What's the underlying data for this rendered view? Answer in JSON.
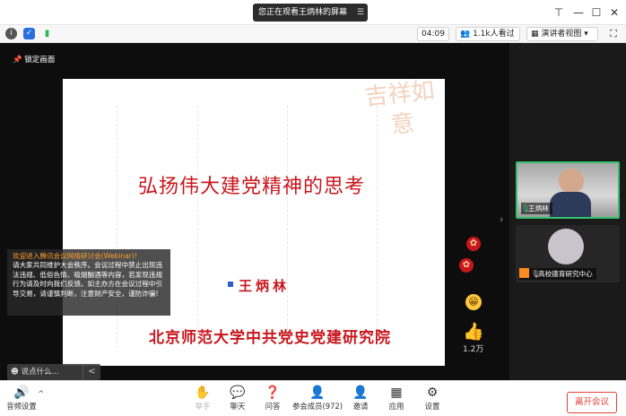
{
  "window": {
    "screen_notice": "您正在观看王炳林的屏幕",
    "minimize": "—",
    "maximize": "☐",
    "close": "✕",
    "pin": "⊤",
    "menu_glyph": "☰"
  },
  "info_bar": {
    "timer": "04:09",
    "viewers": "1.1k人看过",
    "view_mode": "演讲者视图",
    "fullscreen_glyph": "⛶"
  },
  "stage": {
    "lock_label": "锁定画面",
    "slide": {
      "title": "弘扬伟大建党精神的思考",
      "author": "王炳林",
      "institution": "北京师范大学中共党史党建研究院",
      "seal_text": "吉祥如意"
    },
    "likes": "1.2万"
  },
  "notice": {
    "title": "欢迎进入腾讯会议网络研讨会(Webinar)!",
    "body": "请大家共同维护大会秩序。会议过程中禁止出现违法违规、低俗色情、吸烟酗酒等内容，若发现违规行为请及时向我们反馈。如主办方在会议过程中引导交易，请谨慎判断，注意财产安全，谨防诈骗!"
  },
  "chat": {
    "placeholder": "说点什么...",
    "collapse": "<"
  },
  "videos": [
    {
      "name": "王炳林"
    },
    {
      "name": "高校德育研究中心"
    }
  ],
  "toolbar": {
    "audio": "音频设置",
    "raise_hand": "举手",
    "chat": "聊天",
    "qa": "问答",
    "members": "参会成员(972)",
    "invite": "邀请",
    "apps": "应用",
    "settings": "设置",
    "leave": "离开会议"
  },
  "colors": {
    "accent_red": "#c8161d",
    "speaking_green": "#32c26a",
    "leave_red": "#e0403a",
    "notice_orange": "#ff9f2e"
  }
}
